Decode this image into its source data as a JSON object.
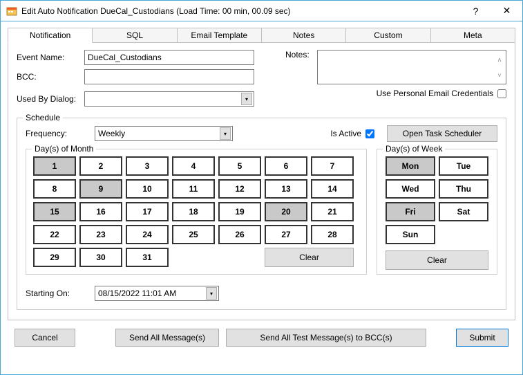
{
  "window": {
    "title": "Edit Auto Notification DueCal_Custodians (Load Time: 00 min, 00.09 sec)",
    "help_glyph": "?",
    "close_glyph": "✕"
  },
  "tabs": [
    "Notification",
    "SQL",
    "Email Template",
    "Notes",
    "Custom",
    "Meta"
  ],
  "labels": {
    "event_name": "Event Name:",
    "bcc": "BCC:",
    "used_by_dialog": "Used By Dialog:",
    "notes": "Notes:",
    "pec": "Use Personal Email Credentials",
    "schedule": "Schedule",
    "frequency": "Frequency:",
    "is_active": "Is Active",
    "open_ts": "Open Task Scheduler",
    "dom": "Day(s) of Month",
    "dow": "Day(s) of Week",
    "clear": "Clear",
    "starting_on": "Starting On:"
  },
  "fields": {
    "event_name": "DueCal_Custodians",
    "bcc": "",
    "used_by_dialog": "",
    "notes": "",
    "pec_checked": false,
    "frequency": "Weekly",
    "is_active_checked": true,
    "starting_on": "08/15/2022 11:01 AM"
  },
  "days_of_month": {
    "items": [
      "1",
      "2",
      "3",
      "4",
      "5",
      "6",
      "7",
      "8",
      "9",
      "10",
      "11",
      "12",
      "13",
      "14",
      "15",
      "16",
      "17",
      "18",
      "19",
      "20",
      "21",
      "22",
      "23",
      "24",
      "25",
      "26",
      "27",
      "28",
      "29",
      "30",
      "31"
    ],
    "selected": [
      "1",
      "9",
      "15",
      "20"
    ]
  },
  "days_of_week": {
    "items": [
      "Mon",
      "Tue",
      "Wed",
      "Thu",
      "Fri",
      "Sat",
      "Sun"
    ],
    "selected": [
      "Mon",
      "Fri"
    ]
  },
  "buttons": {
    "cancel": "Cancel",
    "send_all": "Send All Message(s)",
    "send_all_test": "Send All Test Message(s) to BCC(s)",
    "submit": "Submit"
  }
}
